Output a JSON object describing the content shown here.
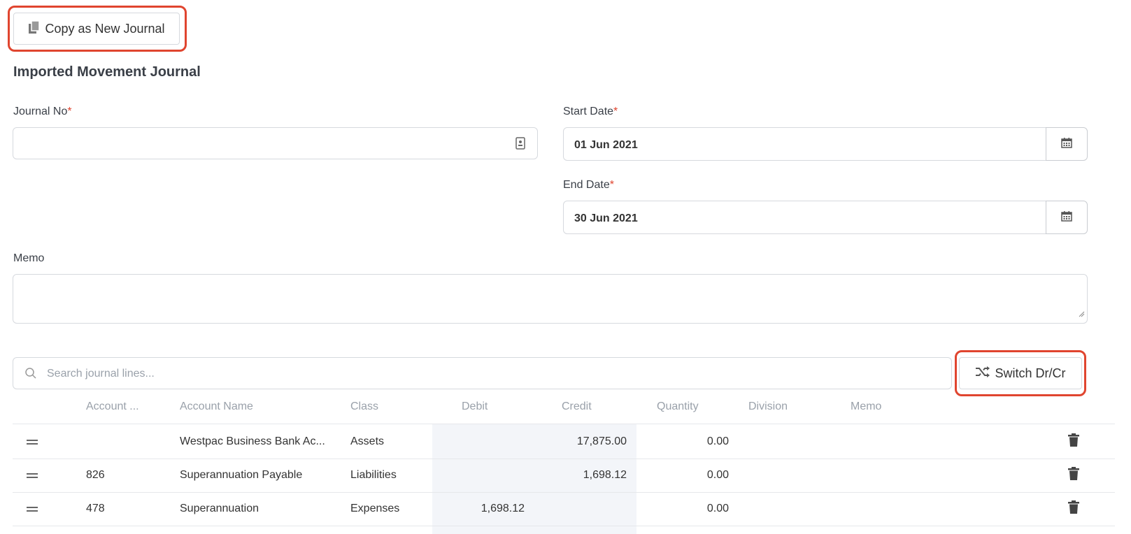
{
  "toolbar": {
    "copy_label": "Copy as New Journal"
  },
  "page": {
    "title": "Imported Movement Journal"
  },
  "form": {
    "journal_no": {
      "label": "Journal No",
      "required_mark": "*",
      "value": ""
    },
    "start_date": {
      "label": "Start Date",
      "required_mark": "*",
      "value": "01 Jun 2021"
    },
    "end_date": {
      "label": "End Date",
      "required_mark": "*",
      "value": "30 Jun 2021"
    },
    "memo": {
      "label": "Memo",
      "value": ""
    }
  },
  "search": {
    "placeholder": "Search journal lines..."
  },
  "switch_button": {
    "label": "Switch Dr/Cr"
  },
  "table": {
    "headers": [
      "Account ...",
      "Account Name",
      "Class",
      "Debit",
      "Credit",
      "Quantity",
      "Division",
      "Memo"
    ],
    "rows": [
      {
        "account": "",
        "name": "Westpac Business Bank Ac...",
        "class": "Assets",
        "debit": "",
        "credit": "17,875.00",
        "quantity": "0.00",
        "division": "",
        "memo": ""
      },
      {
        "account": "826",
        "name": "Superannuation Payable",
        "class": "Liabilities",
        "debit": "",
        "credit": "1,698.12",
        "quantity": "0.00",
        "division": "",
        "memo": ""
      },
      {
        "account": "478",
        "name": "Superannuation",
        "class": "Expenses",
        "debit": "1,698.12",
        "credit": "",
        "quantity": "0.00",
        "division": "",
        "memo": ""
      }
    ]
  },
  "colors": {
    "highlight": "#e0452f",
    "required": "#e0452f",
    "debit_bg": "#f3f5f9"
  }
}
